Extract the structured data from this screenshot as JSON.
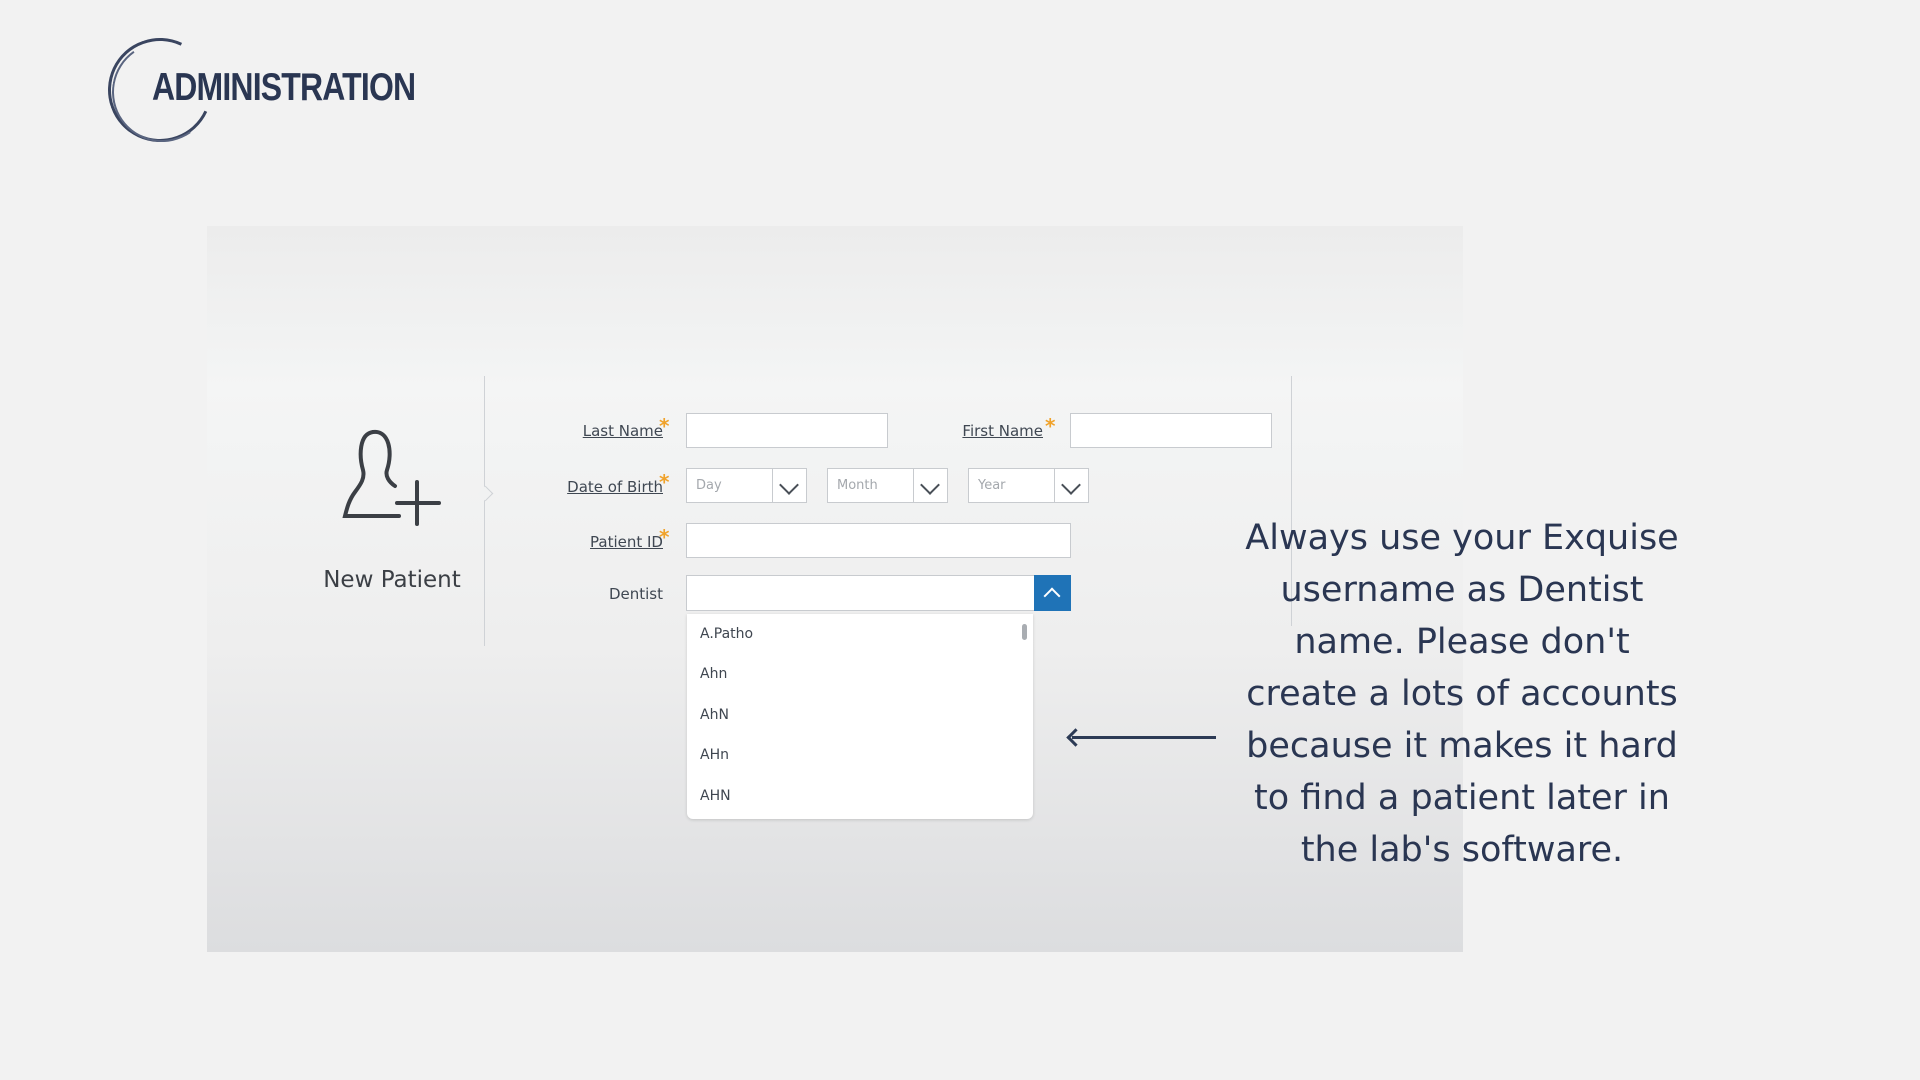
{
  "header": {
    "logo_text": "ADMINISTRATION"
  },
  "panel": {
    "icon": "add-user-icon",
    "new_patient_label": "New Patient",
    "form": {
      "last_name_label": "Last Name",
      "first_name_label": "First Name",
      "dob_label": "Date of Birth",
      "patient_id_label": "Patient ID",
      "dentist_label": "Dentist",
      "required_marker": "*",
      "day_placeholder": "Day",
      "month_placeholder": "Month",
      "year_placeholder": "Year"
    },
    "dentist_options": [
      "A.Patho",
      "Ahn",
      "AhN",
      "AHn",
      "AHN"
    ]
  },
  "annotation": {
    "note": "Always use your Exquise username as Dentist name. Please don't create a lots of accounts because it makes it hard to find a patient later in the lab's software."
  },
  "colors": {
    "accent": "#1f73b7",
    "required": "#f0a22a",
    "heading": "#2a3652"
  }
}
